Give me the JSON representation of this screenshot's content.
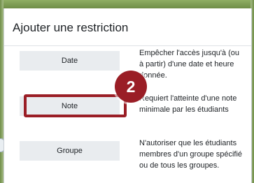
{
  "dialog": {
    "title": "Ajouter une restriction"
  },
  "options": [
    {
      "label": "Date",
      "description": "Empêcher l'accès jusqu'à (ou à partir) d'une date et heure donnée."
    },
    {
      "label": "Note",
      "description": "Requiert l'atteinte d'une note minimale par les étudiants"
    },
    {
      "label": "Groupe",
      "description": "N'autoriser que les étudiants membres d'un groupe spécifié ou de tous les groupes."
    }
  ],
  "annotation": {
    "step_number": "2",
    "color": "#9a1e26"
  }
}
